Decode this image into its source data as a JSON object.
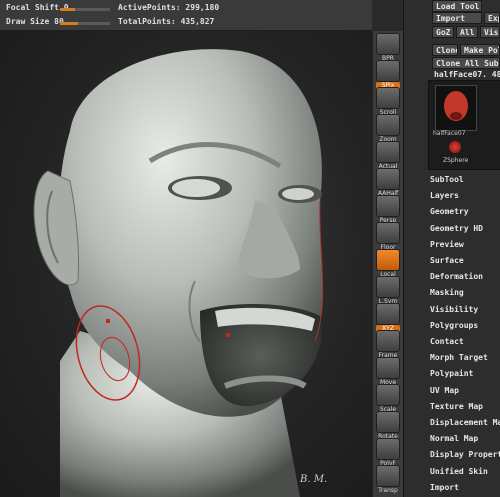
{
  "topbar": {
    "focal_shift_label": "Focal Shift 0",
    "focal_shift_value": 0.3,
    "draw_size_label": "Draw Size 80",
    "draw_size_value": 0.35,
    "active_points": "ActivePoints: 299,180",
    "total_points": "TotalPoints: 435,827"
  },
  "toolstrip": {
    "items": [
      "BPR",
      "SPix",
      "Scroll",
      "Zoom",
      "Actual",
      "AAHalf",
      "Persp",
      "Floor",
      "Local",
      "L.Sym",
      "XYZ",
      "Frame",
      "Move",
      "Scale",
      "Rotate",
      "PolyF",
      "Transp"
    ]
  },
  "panel": {
    "load_tool": "Load Tool",
    "import": "Import",
    "export": "Exp",
    "goz": "GoZ",
    "all": "All",
    "visible": "Visi",
    "clone": "Clone",
    "make_poly": "Make Poly",
    "clone_all": "Clone All SubToo",
    "tool_name": "halfFace07. 48",
    "thumb_label": "halfFace07",
    "thumb2_label": "ZSphere",
    "menu": [
      "SubTool",
      "Layers",
      "Geometry",
      "Geometry HD",
      "Preview",
      "Surface",
      "Deformation",
      "Masking",
      "Visibility",
      "Polygroups",
      "Contact",
      "Morph Target",
      "Polypaint",
      "UV Map",
      "Texture Map",
      "Displacement Map",
      "Normal Map",
      "Display Properties",
      "Unified Skin",
      "Import"
    ]
  },
  "colors": {
    "accent": "#d8701a",
    "brush_ring": "#c0281e"
  }
}
